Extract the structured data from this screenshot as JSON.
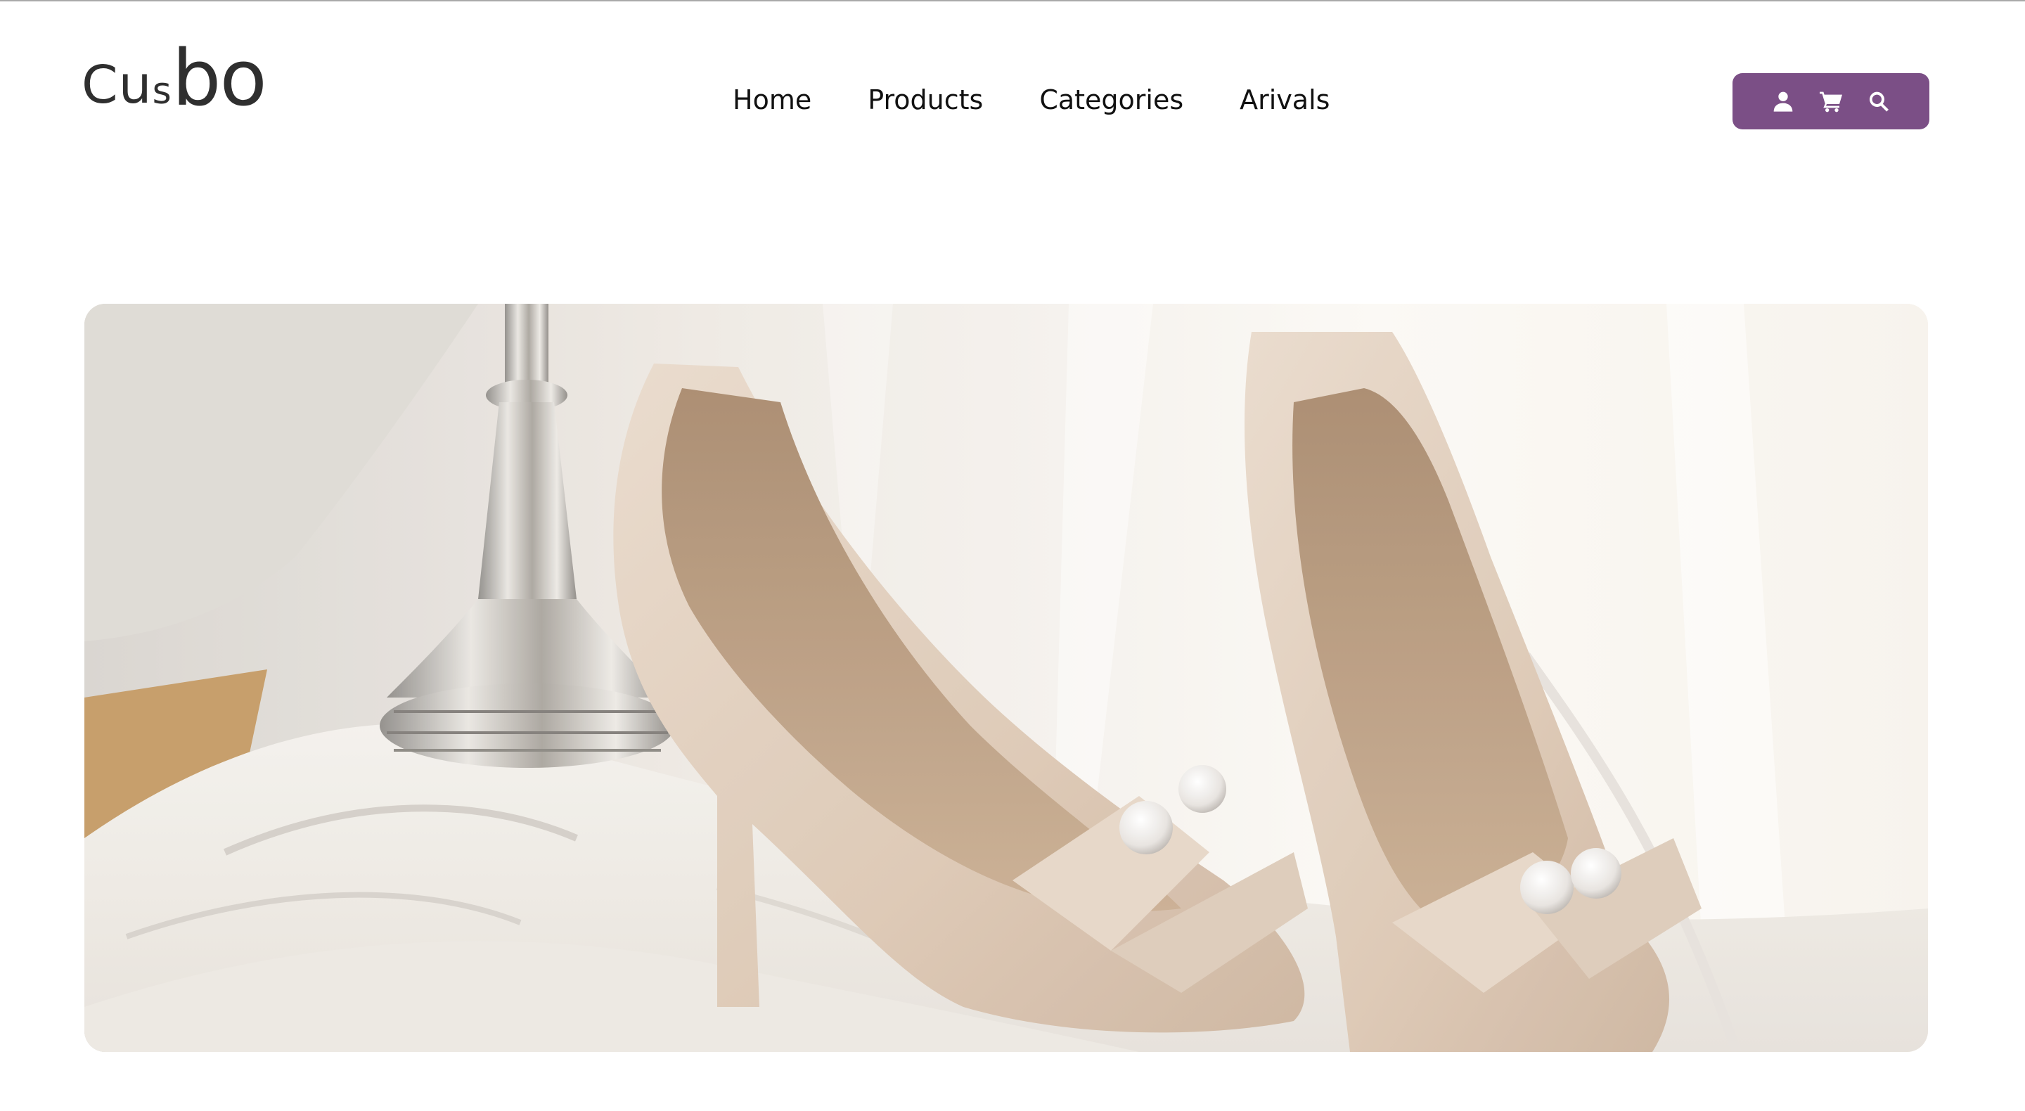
{
  "header": {
    "logo": {
      "part1": "Cu",
      "part2": "s",
      "part3": "bo"
    },
    "nav": [
      {
        "label": "Home"
      },
      {
        "label": "Products"
      },
      {
        "label": "Categories"
      },
      {
        "label": "Arivals"
      }
    ],
    "actions": {
      "accent_color": "#7b4f86",
      "icons": [
        "user-icon",
        "cart-icon",
        "search-icon"
      ]
    }
  },
  "hero": {
    "image": "beige-peep-toe-high-heels-with-pearl-bows-on-white-fabric"
  }
}
